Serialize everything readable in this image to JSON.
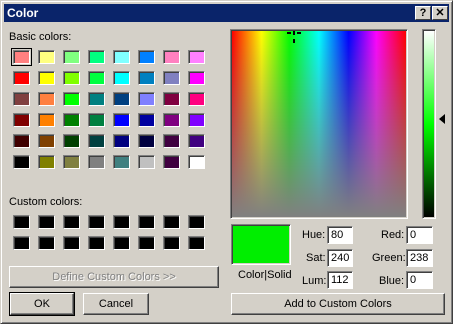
{
  "window": {
    "title": "Color",
    "help_label": "?",
    "close_label": "✕"
  },
  "basic": {
    "label": "Basic colors:",
    "rows": [
      [
        "#ff8080",
        "#ffff80",
        "#80ff80",
        "#00ff80",
        "#80ffff",
        "#0080ff",
        "#ff80c0",
        "#ff80ff"
      ],
      [
        "#ff0000",
        "#ffff00",
        "#80ff00",
        "#00ff40",
        "#00ffff",
        "#0080c0",
        "#8080c0",
        "#ff00ff"
      ],
      [
        "#804040",
        "#ff8040",
        "#00ff00",
        "#008080",
        "#004080",
        "#8080ff",
        "#800040",
        "#ff0080"
      ],
      [
        "#800000",
        "#ff8000",
        "#008000",
        "#008040",
        "#0000ff",
        "#0000a0",
        "#800080",
        "#8000ff"
      ],
      [
        "#400000",
        "#804000",
        "#004000",
        "#004040",
        "#000080",
        "#000040",
        "#400040",
        "#400080"
      ],
      [
        "#000000",
        "#808000",
        "#808040",
        "#808080",
        "#408080",
        "#c0c0c0",
        "#400040",
        "#ffffff"
      ]
    ]
  },
  "custom": {
    "label": "Custom colors:",
    "rows": [
      [
        "#000000",
        "#000000",
        "#000000",
        "#000000",
        "#000000",
        "#000000",
        "#000000",
        "#000000"
      ],
      [
        "#000000",
        "#000000",
        "#000000",
        "#000000",
        "#000000",
        "#000000",
        "#000000",
        "#000000"
      ]
    ]
  },
  "buttons": {
    "define_custom": "Define Custom Colors >>",
    "ok": "OK",
    "cancel": "Cancel",
    "add_custom": "Add to Custom Colors"
  },
  "preview": {
    "label": "Color|Solid",
    "color": "#00ee00"
  },
  "values": {
    "hue_label": "Hue:",
    "hue": "80",
    "sat_label": "Sat:",
    "sat": "240",
    "lum_label": "Lum:",
    "lum": "112",
    "red_label": "Red:",
    "red": "0",
    "green_label": "Green:",
    "green": "238",
    "blue_label": "Blue:",
    "blue": "0"
  },
  "colors": {
    "titlebar": "#0a246a",
    "face": "#d4d0c8",
    "selected_swatch": "#ff8080"
  }
}
